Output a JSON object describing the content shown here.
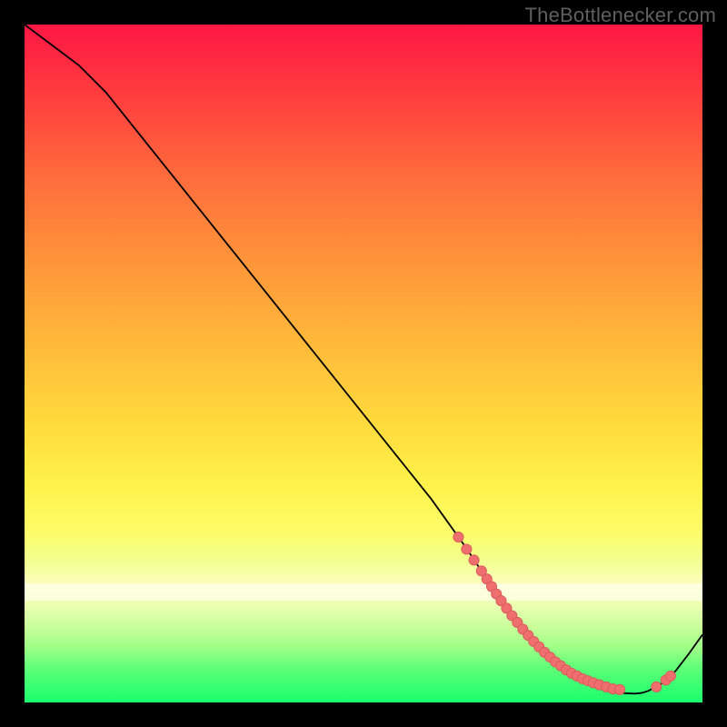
{
  "watermark": {
    "text": "TheBottlenecker.com"
  },
  "colors": {
    "curve_stroke": "#000000",
    "marker_fill": "#ef6e6e",
    "marker_stroke": "#d85a5a",
    "background": "#000000"
  },
  "chart_data": {
    "type": "line",
    "title": "",
    "xlabel": "",
    "ylabel": "",
    "xlim": [
      0,
      100
    ],
    "ylim": [
      0,
      100
    ],
    "x": [
      0,
      4,
      8,
      12,
      20,
      30,
      40,
      50,
      60,
      65,
      68,
      70,
      72,
      74,
      76,
      78,
      80,
      82,
      84,
      86,
      88,
      90,
      91,
      92,
      94,
      96,
      98,
      100
    ],
    "y": [
      100,
      97,
      94,
      90,
      80,
      67.5,
      55,
      42.5,
      30,
      23,
      18.5,
      15.5,
      12.5,
      10,
      8,
      6,
      4.5,
      3.3,
      2.4,
      1.8,
      1.4,
      1.3,
      1.4,
      1.7,
      2.8,
      4.6,
      7.2,
      10
    ],
    "markers": {
      "x": [
        64,
        65.2,
        66.3,
        67.4,
        68.2,
        68.9,
        69.6,
        70.3,
        71.1,
        71.9,
        72.7,
        73.5,
        74.3,
        75.1,
        75.9,
        76.7,
        77.5,
        78.3,
        79.1,
        79.9,
        80.7,
        81.5,
        82.3,
        83.1,
        83.9,
        84.8,
        85.8,
        86.8,
        87.8,
        93.2,
        94.6,
        95.3
      ],
      "y": [
        24.4,
        22.6,
        21.0,
        19.4,
        18.2,
        17.1,
        16.0,
        15.0,
        13.9,
        12.8,
        11.8,
        10.8,
        9.9,
        9.0,
        8.2,
        7.4,
        6.7,
        6.0,
        5.4,
        4.8,
        4.3,
        3.9,
        3.5,
        3.2,
        2.9,
        2.6,
        2.3,
        2.0,
        1.9,
        2.3,
        3.3,
        3.9
      ]
    }
  }
}
